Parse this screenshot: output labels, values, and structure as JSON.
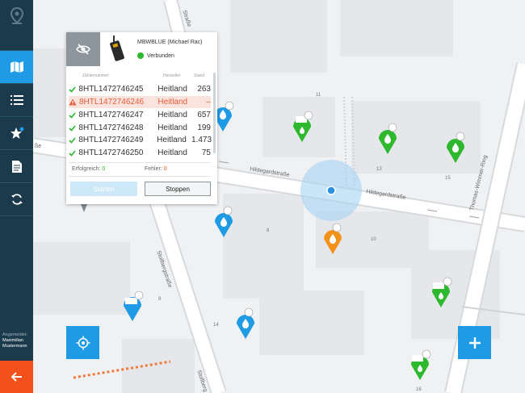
{
  "sidebar": {
    "items": [
      {
        "name": "map",
        "active": true
      },
      {
        "name": "list",
        "active": false
      },
      {
        "name": "favorites",
        "active": false
      },
      {
        "name": "document",
        "active": false
      },
      {
        "name": "sync",
        "active": false
      }
    ],
    "logged_in_label": "Angemeldet:",
    "user_first": "Maximilian",
    "user_last": "Mustermann"
  },
  "device": {
    "name": "MBWBLUE (Michael Rac)",
    "status": "Verbunden"
  },
  "table": {
    "headers": [
      "Zählernummer",
      "Hersteller",
      "Stand"
    ],
    "rows": [
      {
        "serial": "8HTL1472746245",
        "maker": "Heitland",
        "value": "263",
        "state": "ok"
      },
      {
        "serial": "8HTL1472746246",
        "maker": "Heitland",
        "value": "–",
        "state": "error"
      },
      {
        "serial": "8HTL1472746247",
        "maker": "Heitland",
        "value": "657",
        "state": "ok"
      },
      {
        "serial": "8HTL1472746248",
        "maker": "Heitland",
        "value": "199",
        "state": "ok"
      },
      {
        "serial": "8HTL1472746249",
        "maker": "Heitland",
        "value": "1.473",
        "state": "ok"
      },
      {
        "serial": "8HTL1472746250",
        "maker": "Heitland",
        "value": "75",
        "state": "ok"
      }
    ],
    "success_label": "Erfolgreich:",
    "success_count": "0",
    "error_label": "Fehler:",
    "error_count": "0",
    "start_label": "Starten",
    "stop_label": "Stoppen"
  },
  "map": {
    "streets": {
      "hildegard_1": "Hildegardstraße",
      "hildegard_2": "Hildegardstraße",
      "thomas": "Thomas-Wimmer-Ring",
      "stollberg_1": "Stollbergstraße",
      "stollberg_2": "Stollbergstraße",
      "stollberg_top": "Straße",
      "stollberg_bottom": "Stollberg",
      "partial_left": "ße"
    },
    "house_numbers": {
      "n11": "11",
      "n13": "13",
      "n15": "15",
      "n8": "8",
      "n10": "10",
      "n9": "9",
      "n14": "14",
      "n16": "16"
    }
  },
  "colors": {
    "sidebar": "#1b3a4b",
    "accent": "#1e9be4",
    "success": "#2db82d",
    "warning": "#f2921b",
    "error": "#e25b3a",
    "logout": "#f2511b"
  }
}
